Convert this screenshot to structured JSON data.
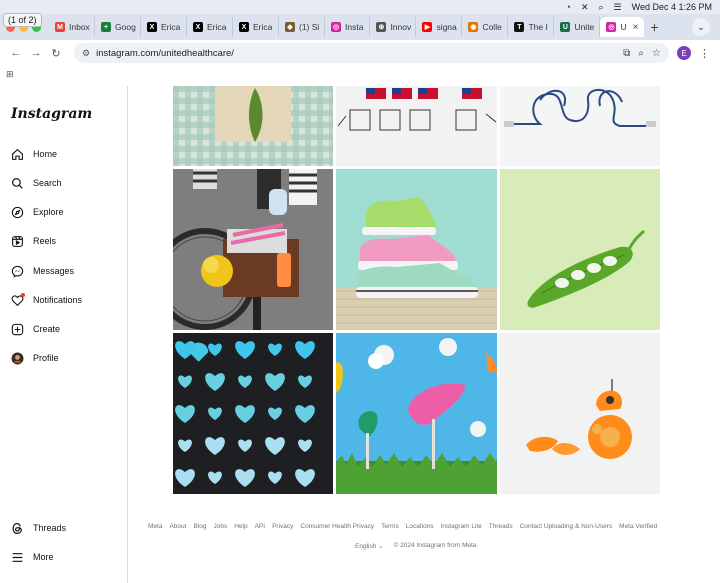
{
  "browser": {
    "page_counter": "(1 of 2)",
    "menubar": {
      "datetime": "Wed Dec 4  1:26 PM"
    },
    "tabs": [
      {
        "label": "Inbox",
        "favicon": "gmail-icon",
        "color": "#ea4335",
        "glyph": "M"
      },
      {
        "label": "Goog",
        "favicon": "google-sheets-icon",
        "color": "#188038",
        "glyph": "+"
      },
      {
        "label": "Erica",
        "favicon": "x-icon",
        "color": "#000000",
        "glyph": "X"
      },
      {
        "label": "Erica",
        "favicon": "x-icon",
        "color": "#000000",
        "glyph": "X"
      },
      {
        "label": "Erica",
        "favicon": "x-icon",
        "color": "#000000",
        "glyph": "X"
      },
      {
        "label": "(1) Si",
        "favicon": "generic-icon",
        "color": "#7a5c2e",
        "glyph": "◆"
      },
      {
        "label": "Insta",
        "favicon": "instagram-icon",
        "color": "#d6249f",
        "glyph": "◎"
      },
      {
        "label": "Innov",
        "favicon": "globe-icon",
        "color": "#555555",
        "glyph": "⊕"
      },
      {
        "label": "signa",
        "favicon": "youtube-icon",
        "color": "#ff0000",
        "glyph": "▶"
      },
      {
        "label": "Colle",
        "favicon": "chrome-icon",
        "color": "#e37400",
        "glyph": "◉"
      },
      {
        "label": "The I",
        "favicon": "nyt-icon",
        "color": "#111111",
        "glyph": "T"
      },
      {
        "label": "Unite",
        "favicon": "document-icon",
        "color": "#1e6b4a",
        "glyph": "U"
      },
      {
        "label": "U",
        "favicon": "instagram-icon",
        "color": "#d6249f",
        "glyph": "◎",
        "active": true
      }
    ],
    "url": "instagram.com/unitedhealthcare/",
    "profile_initial": "E"
  },
  "sidebar": {
    "logo": "Instagram",
    "items": [
      {
        "label": "Home",
        "icon": "home-icon"
      },
      {
        "label": "Search",
        "icon": "search-icon"
      },
      {
        "label": "Explore",
        "icon": "compass-icon"
      },
      {
        "label": "Reels",
        "icon": "reels-icon"
      },
      {
        "label": "Messages",
        "icon": "messenger-icon"
      },
      {
        "label": "Notifications",
        "icon": "heart-icon"
      },
      {
        "label": "Create",
        "icon": "plus-square-icon"
      },
      {
        "label": "Profile",
        "icon": "avatar"
      }
    ],
    "bottom": [
      {
        "label": "Threads",
        "icon": "threads-icon"
      },
      {
        "label": "More",
        "icon": "hamburger-icon"
      }
    ]
  },
  "footer": {
    "links": [
      "Meta",
      "About",
      "Blog",
      "Jobs",
      "Help",
      "API",
      "Privacy",
      "Consumer Health Privacy",
      "Terms",
      "Locations",
      "Instagram Lite",
      "Threads",
      "Contact Uploading & Non-Users",
      "Meta Verified"
    ],
    "language": "English",
    "copyright": "© 2024 Instagram from Meta"
  },
  "colors": {
    "accent": "#0095f6",
    "notification_dot": "#ff3040"
  }
}
